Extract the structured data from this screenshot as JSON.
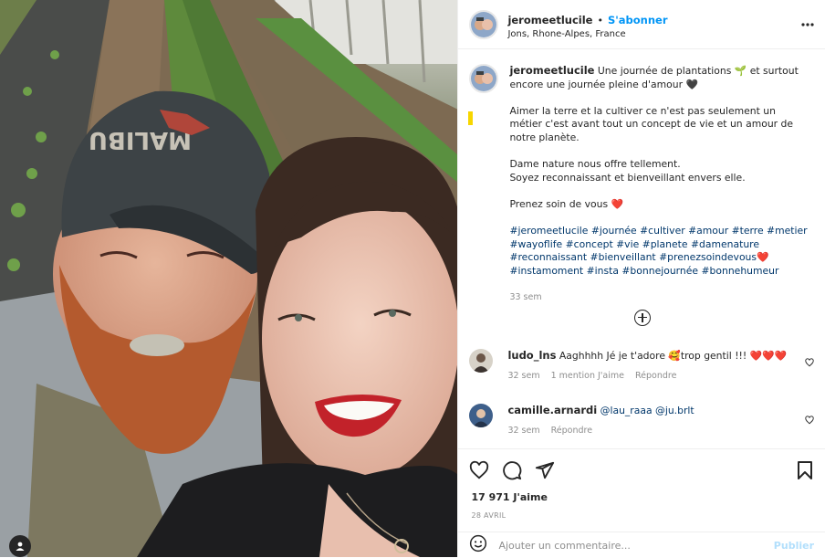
{
  "header": {
    "username": "jeromeetlucile",
    "separator": "•",
    "follow_label": "S'abonner",
    "location": "Jons, Rhone-Alpes, France",
    "more_icon": "more-horizontal-icon"
  },
  "caption": {
    "username": "jeromeetlucile",
    "line1": "Une journée de plantations 🌱 et surtout encore une journée pleine d'amour 🖤",
    "para2": "Aimer la terre et la cultiver ce n'est pas seulement un métier c'est avant tout un concept de vie et un amour de notre planète.",
    "para3a": "Dame nature nous offre tellement.",
    "para3b": "Soyez reconnaissant et bienveillant envers elle.",
    "para4": "Prenez soin de vous ❤️",
    "hashtags": "#jeromeetlucile #journée #cultiver #amour #terre #metier #wayoflife #concept #vie #planete #damenature #reconnaissant #bienveillant #prenezsoindevous❤️ #instamoment #insta #bonnejournée #bonnehumeur",
    "time": "33 sem"
  },
  "comments": [
    {
      "username": "ludo_lns",
      "text": "Aaghhhh Jé je t'adore 🥰trop gentil !!! ❤️❤️❤️",
      "time": "32 sem",
      "likes": "1 mention J'aime",
      "reply": "Répondre"
    },
    {
      "username": "camille.arnardi",
      "text": "@lau_raaa @ju.brlt",
      "time": "32 sem",
      "reply": "Répondre"
    }
  ],
  "likes_count": "17 971 J'aime",
  "post_date": "28 AVRIL",
  "add_comment": {
    "placeholder": "Ajouter un commentaire...",
    "publish_label": "Publier"
  },
  "colors": {
    "accent": "#0095f6",
    "hashtag": "#00376b",
    "muted": "#8e8e8e",
    "publish_disabled": "#b2dffc"
  }
}
